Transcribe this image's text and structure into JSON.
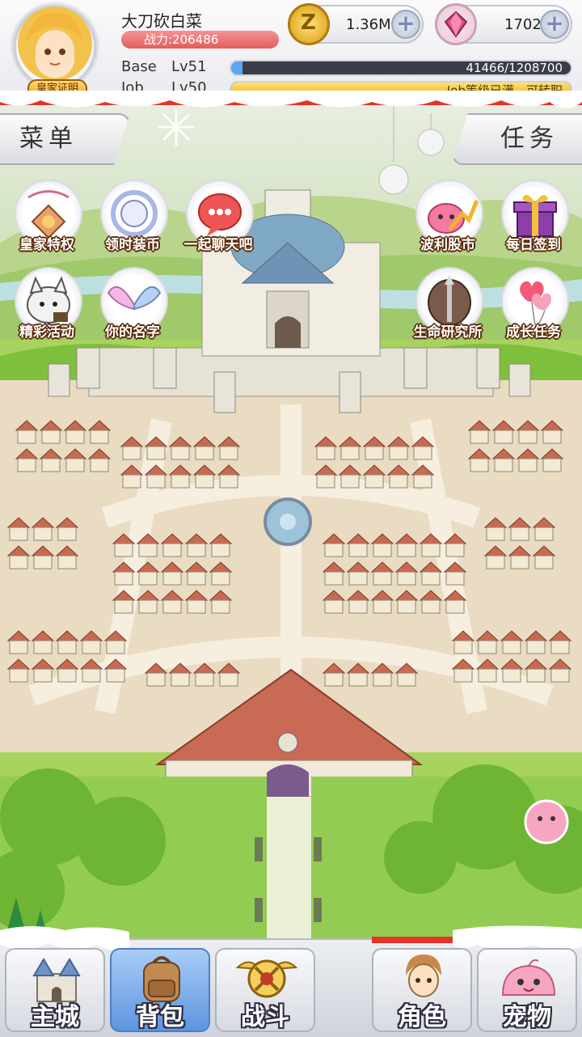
{
  "player": {
    "name": "大刀砍白菜",
    "power_text": "战力:206486",
    "badge": "皇家证明"
  },
  "currency": {
    "zeny": "1.36M",
    "gems": "1702"
  },
  "levels": {
    "base_label": "Base",
    "base_level": "Lv51",
    "base_exp": "41466/1208700",
    "base_progress": 0.034,
    "job_label": "Job",
    "job_level": "Lv50",
    "job_exp": "Job等级已满，可转职",
    "job_progress": 1.0
  },
  "tabs": {
    "menu": "菜单",
    "task": "任务"
  },
  "left_buttons": [
    {
      "label": "皇家特权",
      "icon": "royal-privilege-icon"
    },
    {
      "label": "领时装币",
      "icon": "costume-coin-icon"
    },
    {
      "label": "一起聊天吧",
      "icon": "chat-bubble-icon"
    },
    {
      "label": "精彩活动",
      "icon": "event-cat-icon"
    },
    {
      "label": "你的名字",
      "icon": "angel-wings-icon"
    }
  ],
  "right_buttons": [
    {
      "label": "波利股市",
      "icon": "poring-stock-icon"
    },
    {
      "label": "每日签到",
      "icon": "gift-box-icon"
    },
    {
      "label": "生命研究所",
      "icon": "life-lab-icon"
    },
    {
      "label": "成长任务",
      "icon": "balloon-hearts-icon"
    }
  ],
  "bottom_nav": [
    {
      "label": "主城",
      "icon": "castle-icon",
      "active": false
    },
    {
      "label": "背包",
      "icon": "backpack-icon",
      "active": true
    },
    {
      "label": "战斗",
      "icon": "battle-emblem-icon",
      "active": false
    },
    {
      "label": "角色",
      "icon": "character-icon",
      "active": false
    },
    {
      "label": "宠物",
      "icon": "pet-poring-icon",
      "active": false
    }
  ],
  "colors": {
    "power_bar": "#e86a6a",
    "base_bar": "#5aa6f2",
    "job_bar": "#f4c430",
    "active_nav": "#6aa3e8"
  }
}
